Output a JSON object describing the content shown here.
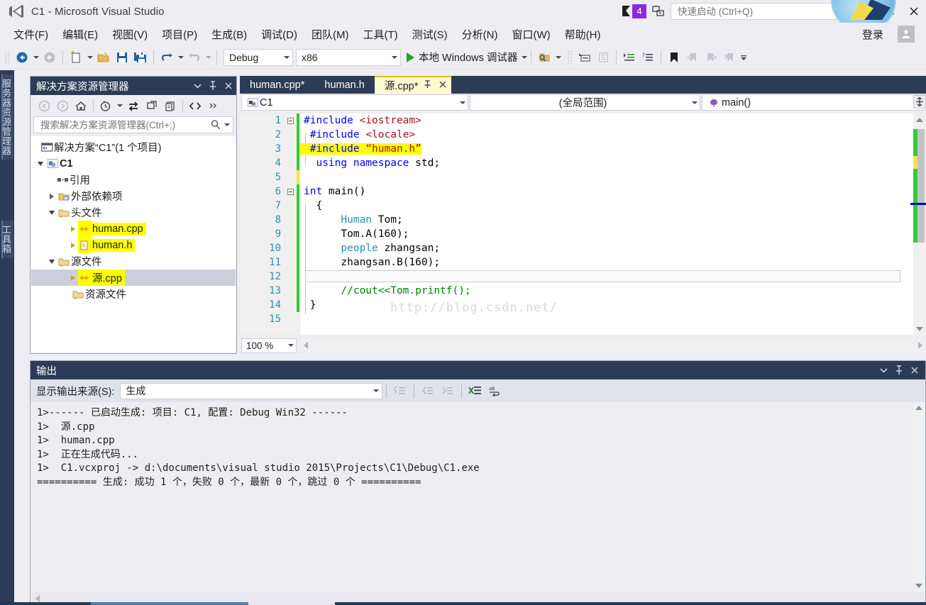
{
  "window": {
    "title": "C1 - Microsoft Visual Studio",
    "logo_icon": "visual-studio-logo-icon",
    "minimize_icon": "minimize-icon",
    "maximize_icon": "maximize-icon",
    "close_icon": "close-icon",
    "notification_count": "4",
    "notification_icon": "flag-icon",
    "feedback_icon": "feedback-icon"
  },
  "quick_launch": {
    "placeholder": "快速启动 (Ctrl+Q)",
    "value": "",
    "search_icon": "search-icon"
  },
  "menubar": {
    "items": [
      {
        "label": "文件(F)"
      },
      {
        "label": "编辑(E)"
      },
      {
        "label": "视图(V)"
      },
      {
        "label": "项目(P)"
      },
      {
        "label": "生成(B)"
      },
      {
        "label": "调试(D)"
      },
      {
        "label": "团队(M)"
      },
      {
        "label": "工具(T)"
      },
      {
        "label": "测试(S)"
      },
      {
        "label": "分析(N)"
      },
      {
        "label": "窗口(W)"
      },
      {
        "label": "帮助(H)"
      }
    ],
    "signin_label": "登录",
    "signin_icon": "user-account-icon"
  },
  "toolbar": {
    "config_value": "Debug",
    "platform_value": "x86",
    "run_label": "本地 Windows 调试器",
    "icons": [
      "navigate-back-icon",
      "navigate-forward-icon",
      "new-project-icon",
      "open-file-icon",
      "save-icon",
      "save-all-icon",
      "undo-icon",
      "redo-icon",
      "start-debug-icon",
      "find-in-files-icon",
      "comment-selection-icon",
      "uncomment-selection-icon",
      "increase-indent-icon",
      "decrease-indent-icon",
      "toggle-bookmark-icon",
      "previous-bookmark-icon",
      "next-bookmark-icon",
      "clear-bookmarks-icon"
    ]
  },
  "left_dock": {
    "tabs": [
      {
        "label": "服务器资源管理器"
      },
      {
        "label": "工具箱"
      }
    ]
  },
  "solution_explorer": {
    "title": "解决方案资源管理器",
    "dropdown_icon": "chevron-down-icon",
    "pin_icon": "pin-icon",
    "close_icon": "close-icon",
    "toolbar_icons": [
      "back-icon",
      "forward-icon",
      "home-icon",
      "pending-changes-icon",
      "sync-with-active-document-icon",
      "refresh-icon",
      "collapse-all-icon",
      "show-all-files-icon",
      "properties-icon"
    ],
    "search_placeholder": "搜索解决方案资源管理器(Ctrl+;)",
    "search_value": "",
    "tree": [
      {
        "label": "解决方案“C1”(1 个项目)",
        "icon": "solution-icon",
        "indent": 0,
        "expander": "none",
        "highlight": false,
        "bold": false,
        "selected": false
      },
      {
        "label": "C1",
        "icon": "project-icon",
        "indent": 1,
        "expander": "down",
        "highlight": false,
        "bold": true,
        "selected": false
      },
      {
        "label": "引用",
        "icon": "references-icon",
        "indent": 2,
        "expander": "none",
        "highlight": false,
        "bold": false,
        "selected": false
      },
      {
        "label": "外部依赖项",
        "icon": "folder-external-icon",
        "indent": 2,
        "expander": "right",
        "highlight": false,
        "bold": false,
        "selected": false
      },
      {
        "label": "头文件",
        "icon": "folder-icon",
        "indent": 2,
        "expander": "down",
        "highlight": false,
        "bold": false,
        "selected": false
      },
      {
        "label": "human.cpp",
        "icon": "cpp-file-icon",
        "indent": 3,
        "expander": "right",
        "highlight": true,
        "bold": false,
        "selected": false
      },
      {
        "label": "human.h",
        "icon": "h-file-icon",
        "indent": 3,
        "expander": "right",
        "highlight": true,
        "bold": false,
        "selected": false
      },
      {
        "label": "源文件",
        "icon": "folder-icon",
        "indent": 2,
        "expander": "down",
        "highlight": false,
        "bold": false,
        "selected": false
      },
      {
        "label": "源.cpp",
        "icon": "cpp-file-icon",
        "indent": 3,
        "expander": "right",
        "highlight": true,
        "bold": false,
        "selected": true
      },
      {
        "label": "资源文件",
        "icon": "folder-icon",
        "indent": 2,
        "expander": "none",
        "highlight": false,
        "bold": false,
        "selected": false
      }
    ]
  },
  "editor": {
    "tabs": [
      {
        "label": "human.cpp*",
        "active": false
      },
      {
        "label": "human.h",
        "active": false
      },
      {
        "label": "源.cpp*",
        "active": true
      }
    ],
    "tab_pin_icon": "pin-icon",
    "tab_close_icon": "close-icon",
    "nav": {
      "project": "C1",
      "project_icon": "project-icon",
      "scope": "(全局范围)",
      "member": "main()",
      "member_icon": "method-icon",
      "dropdown_icon": "chevron-down-icon"
    },
    "zoom_level": "100 %",
    "watermark": "http://blog.csdn.net/",
    "split_icon": "split-view-icon",
    "code_lines": [
      {
        "no": "1",
        "fold": "minus",
        "change": "green",
        "segments": [
          {
            "t": "#include ",
            "c": "pp"
          },
          {
            "t": "<iostream>",
            "c": "str"
          }
        ]
      },
      {
        "no": "2",
        "fold": "none",
        "change": "green",
        "segments": [
          {
            "t": " #include ",
            "c": "pp"
          },
          {
            "t": "<locale>",
            "c": "str"
          }
        ]
      },
      {
        "no": "3",
        "fold": "none",
        "change": "green",
        "highlight": true,
        "segments": [
          {
            "t": " #include ",
            "c": "pp"
          },
          {
            "t": "“human.h”",
            "c": "str"
          }
        ]
      },
      {
        "no": "4",
        "fold": "none",
        "change": "green",
        "segments": [
          {
            "t": "  using namespace ",
            "c": "kw"
          },
          {
            "t": "std;",
            "c": "plain"
          }
        ]
      },
      {
        "no": "5",
        "fold": "none",
        "change": "yellow",
        "segments": [
          {
            "t": "",
            "c": "plain"
          }
        ]
      },
      {
        "no": "6",
        "fold": "minus",
        "change": "green",
        "segments": [
          {
            "t": "int ",
            "c": "kw"
          },
          {
            "t": "main()",
            "c": "plain"
          }
        ]
      },
      {
        "no": "7",
        "fold": "none",
        "change": "green",
        "segments": [
          {
            "t": "  {",
            "c": "plain"
          }
        ]
      },
      {
        "no": "8",
        "fold": "none",
        "change": "green",
        "segments": [
          {
            "t": "      ",
            "c": "plain"
          },
          {
            "t": "Human",
            "c": "typ"
          },
          {
            "t": " Tom;",
            "c": "plain"
          }
        ]
      },
      {
        "no": "9",
        "fold": "none",
        "change": "green",
        "segments": [
          {
            "t": "      Tom.A(160);",
            "c": "plain"
          }
        ]
      },
      {
        "no": "10",
        "fold": "none",
        "change": "green",
        "segments": [
          {
            "t": "      ",
            "c": "plain"
          },
          {
            "t": "people",
            "c": "typ"
          },
          {
            "t": " zhangsan;",
            "c": "plain"
          }
        ]
      },
      {
        "no": "11",
        "fold": "none",
        "change": "green",
        "segments": [
          {
            "t": "      zhangsan.B(160);",
            "c": "plain"
          }
        ]
      },
      {
        "no": "12",
        "fold": "none",
        "change": "green",
        "current": true,
        "segments": [
          {
            "t": "",
            "c": "plain"
          }
        ]
      },
      {
        "no": "13",
        "fold": "none",
        "change": "green",
        "segments": [
          {
            "t": "      //cout<<Tom.printf();",
            "c": "cmt"
          }
        ]
      },
      {
        "no": "14",
        "fold": "none",
        "change": "green",
        "segments": [
          {
            "t": " }",
            "c": "plain"
          }
        ]
      },
      {
        "no": "15",
        "fold": "none",
        "change": "none",
        "segments": [
          {
            "t": "",
            "c": "plain"
          }
        ]
      }
    ]
  },
  "output_panel": {
    "title": "输出",
    "dropdown_icon": "chevron-down-icon",
    "pin_icon": "pin-icon",
    "close_icon": "close-icon",
    "source_label": "显示输出来源(S):",
    "source_value": "生成",
    "toolbar_icons": [
      "jump-to-message-icon",
      "go-to-previous-message-icon",
      "go-to-next-message-icon",
      "clear-all-icon",
      "toggle-word-wrap-icon"
    ],
    "lines": [
      "1>------ 已启动生成: 项目: C1, 配置: Debug Win32 ------",
      "1>  源.cpp",
      "1>  human.cpp",
      "1>  正在生成代码...",
      "1>  C1.vcxproj -> d:\\documents\\visual studio 2015\\Projects\\C1\\Debug\\C1.exe",
      "========== 生成: 成功 1 个，失败 0 个，最新 0 个，跳过 0 个 =========="
    ]
  },
  "colors": {
    "chrome": "#eeeef2",
    "panel_header": "#2d3c56",
    "active_tab": "#fff9d0",
    "highlight": "#ffff00",
    "accent_purple": "#8a2be2",
    "keyword_blue": "#0000ff",
    "string_red": "#a31515",
    "type_teal": "#2b91af",
    "comment_green": "#008000",
    "change_green": "#32cd32",
    "change_yellow": "#ffe14d"
  }
}
